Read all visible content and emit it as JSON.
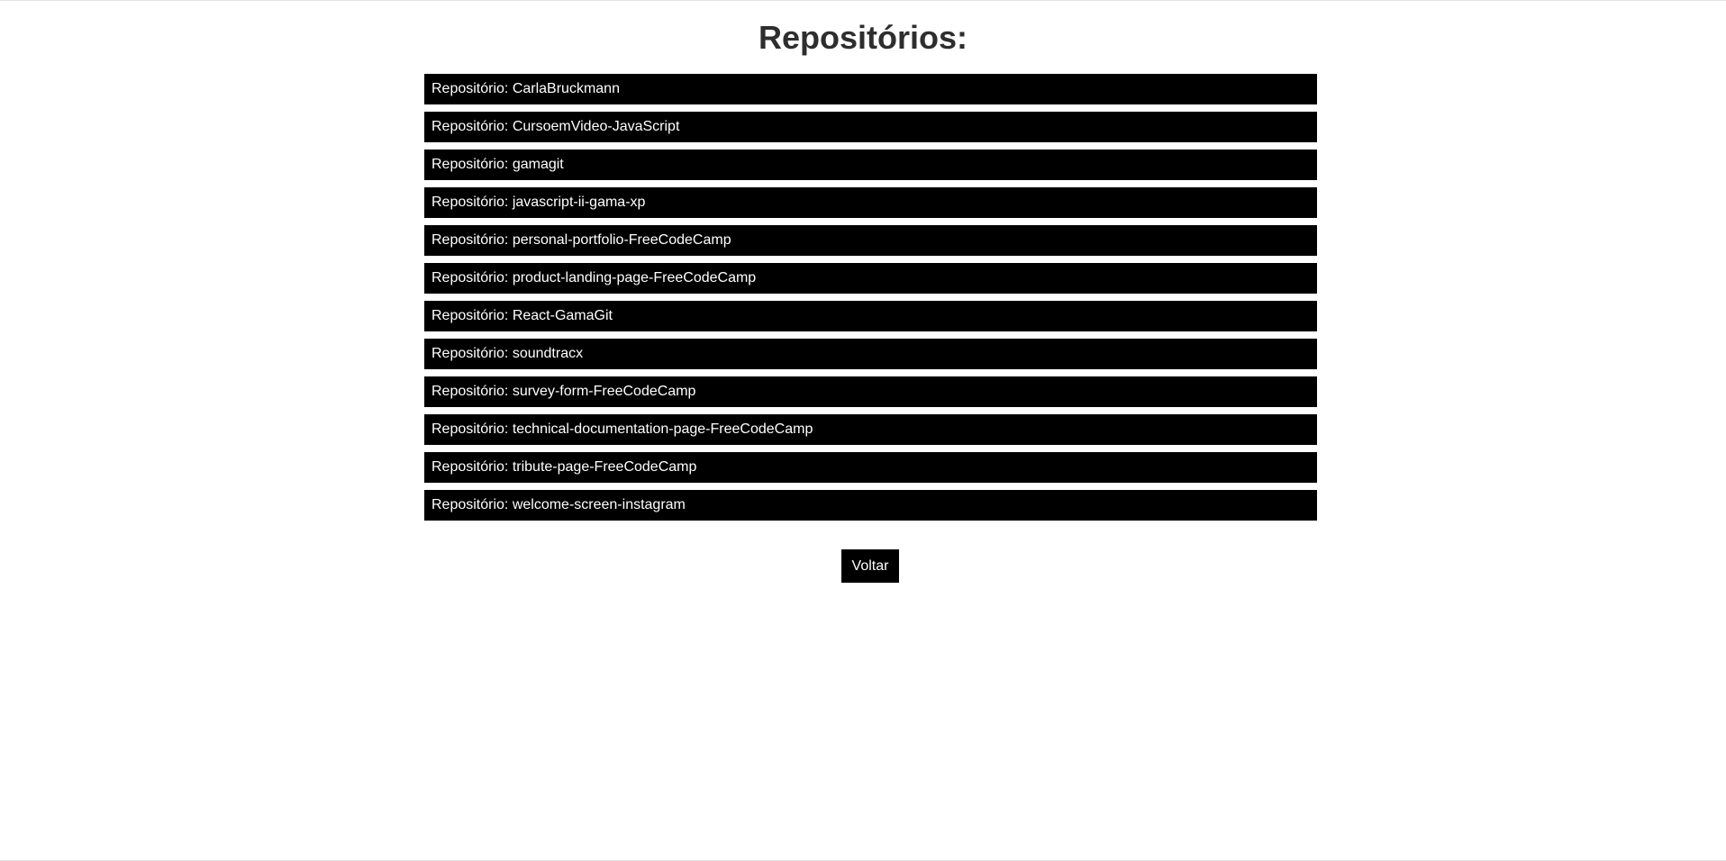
{
  "page": {
    "title": "Repositórios:"
  },
  "repositories": {
    "prefix": "Repositório: ",
    "items": [
      "CarlaBruckmann",
      "CursoemVideo-JavaScript",
      "gamagit",
      "javascript-ii-gama-xp",
      "personal-portfolio-FreeCodeCamp",
      "product-landing-page-FreeCodeCamp",
      "React-GamaGit",
      "soundtracx",
      "survey-form-FreeCodeCamp",
      "technical-documentation-page-FreeCodeCamp",
      "tribute-page-FreeCodeCamp",
      "welcome-screen-instagram"
    ]
  },
  "actions": {
    "back_label": "Voltar"
  },
  "colors": {
    "item_background": "#000000",
    "item_text": "#ffffff",
    "title_text": "#2e2e2e",
    "page_background": "#ffffff"
  }
}
